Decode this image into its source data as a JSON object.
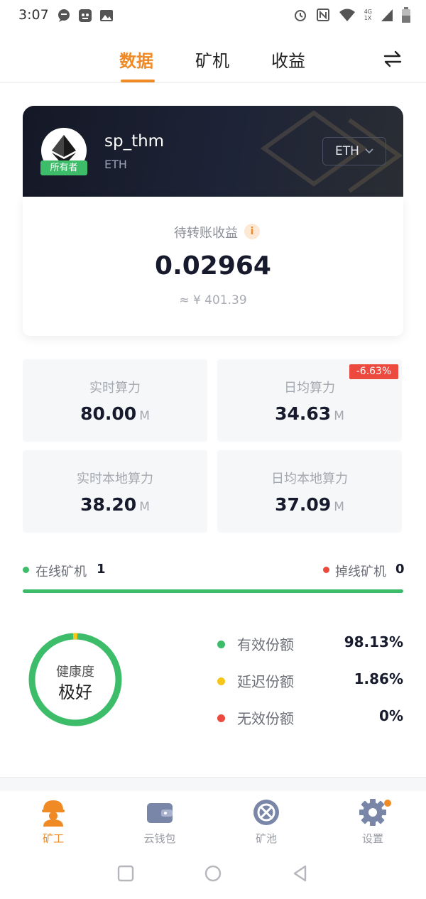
{
  "status_bar": {
    "time": "3:07",
    "network_label_top": "4G",
    "network_label_bottom": "1X",
    "icons": [
      "chat-icon",
      "app-icon",
      "image-icon",
      "alarm-icon",
      "nfc-icon",
      "wifi-icon",
      "signal-icon",
      "battery-icon"
    ]
  },
  "tabs": [
    {
      "label": "数据",
      "active": true
    },
    {
      "label": "矿机",
      "active": false
    },
    {
      "label": "收益",
      "active": false
    }
  ],
  "account": {
    "username": "sp_thm",
    "coin": "ETH",
    "owner_badge": "所有者",
    "coin_select": "ETH"
  },
  "earnings": {
    "title": "待转账收益",
    "info_icon": "i",
    "value": "0.02964",
    "cny": "≈ ¥ 401.39"
  },
  "hashrate": [
    {
      "label": "实时算力",
      "value": "80.00",
      "unit": "M"
    },
    {
      "label": "日均算力",
      "value": "34.63",
      "unit": "M",
      "change": "-6.63%"
    },
    {
      "label": "实时本地算力",
      "value": "38.20",
      "unit": "M"
    },
    {
      "label": "日均本地算力",
      "value": "37.09",
      "unit": "M"
    }
  ],
  "miners": {
    "online_label": "在线矿机",
    "online_count": "1",
    "offline_label": "掉线矿机",
    "offline_count": "0"
  },
  "health": {
    "label": "健康度",
    "value": "极好",
    "shares": [
      {
        "label": "有效份额",
        "value": "98.13%",
        "color": "#3dbd6a"
      },
      {
        "label": "延迟份额",
        "value": "1.86%",
        "color": "#f5c518"
      },
      {
        "label": "无效份额",
        "value": "0%",
        "color": "#ec4a3e"
      }
    ]
  },
  "bottom_nav": [
    {
      "label": "矿工",
      "icon": "miner-icon",
      "active": true
    },
    {
      "label": "云钱包",
      "icon": "wallet-icon",
      "active": false
    },
    {
      "label": "矿池",
      "icon": "pool-icon",
      "active": false
    },
    {
      "label": "设置",
      "icon": "settings-icon",
      "active": false
    }
  ],
  "colors": {
    "accent": "#f08a24",
    "success": "#3dbd6a",
    "danger": "#ec4a3e",
    "warning": "#f5c518"
  }
}
